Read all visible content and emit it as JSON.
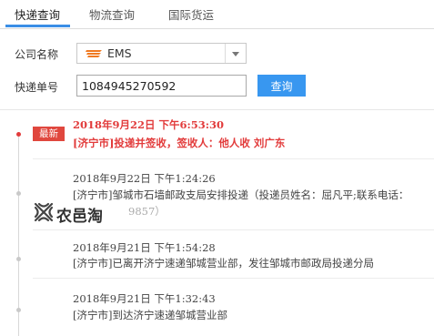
{
  "tabs": [
    {
      "label": "快递查询",
      "active": true
    },
    {
      "label": "物流查询",
      "active": false
    },
    {
      "label": "国际货运",
      "active": false
    }
  ],
  "form": {
    "company_label": "公司名称",
    "company_value": "EMS",
    "number_label": "快递单号",
    "number_value": "1084945270592",
    "query_button": "查询"
  },
  "timeline": {
    "latest_badge": "最新",
    "entries": [
      {
        "time": "2018年9月22日 下午6:53:30",
        "text": "[济宁市]投递并签收，签收人：他人收 刘广东"
      },
      {
        "time": "2018年9月22日 下午1:24:26",
        "text": "[济宁市]邹城市石墙邮政支局安排投递（投递员姓名：屈凡平;联系电话：",
        "text2": "9857）"
      },
      {
        "time": "2018年9月21日 下午1:54:28",
        "text": "[济宁市]已离开济宁速递邹城营业部，发往邹城市邮政局投递分局"
      },
      {
        "time": "2018年9月21日 下午1:32:43",
        "text": "[济宁市]到达济宁速递邹城营业部"
      }
    ]
  },
  "watermark": {
    "text": "农邑淘",
    "icon": "cross-knot-icon"
  },
  "colors": {
    "accent": "#3897f0",
    "latest": "#e23b3b",
    "badge": "#e0473e",
    "ems_logo": "#f07a22"
  }
}
